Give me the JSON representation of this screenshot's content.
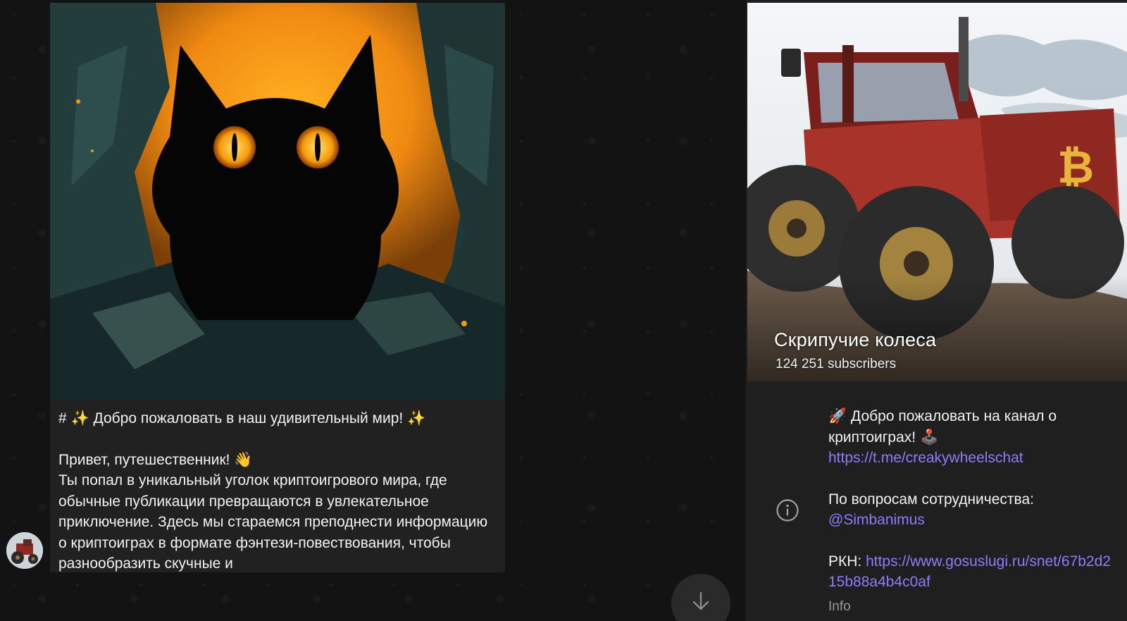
{
  "message": {
    "heading": "# ✨ Добро пожаловать в наш удивительный мир! ✨",
    "greeting": "Привет, путешественник! 👋",
    "body": "Ты попал в уникальный уголок криптоигрового мира, где обычные публикации превращаются в увлекательное приключение. Здесь мы стараемся преподнести информацию о криптоиграх в формате фэнтези-повествования, чтобы разнообразить скучные и"
  },
  "channel": {
    "title": "Скрипучие колеса",
    "subscribers": "124 251 subscribers",
    "description": {
      "welcome": "🚀 Добро пожаловать на канал о криптоиграх! 🕹️",
      "chat_link": "https://t.me/creakywheelschat",
      "collab_label": "По вопросам сотрудничества:",
      "collab_handle": "@Simbanimus",
      "rkn_label": "РКН: ",
      "rkn_link": "https://www.gosuslugi.ru/snet/67b2d215b88a4b4c0af"
    },
    "info_label": "Info"
  },
  "icons": {
    "info": "info-circle-icon",
    "scroll": "arrow-down-icon"
  },
  "colors": {
    "link": "#8c7dff",
    "bubble": "#212121",
    "panel": "#1f1f1f"
  }
}
